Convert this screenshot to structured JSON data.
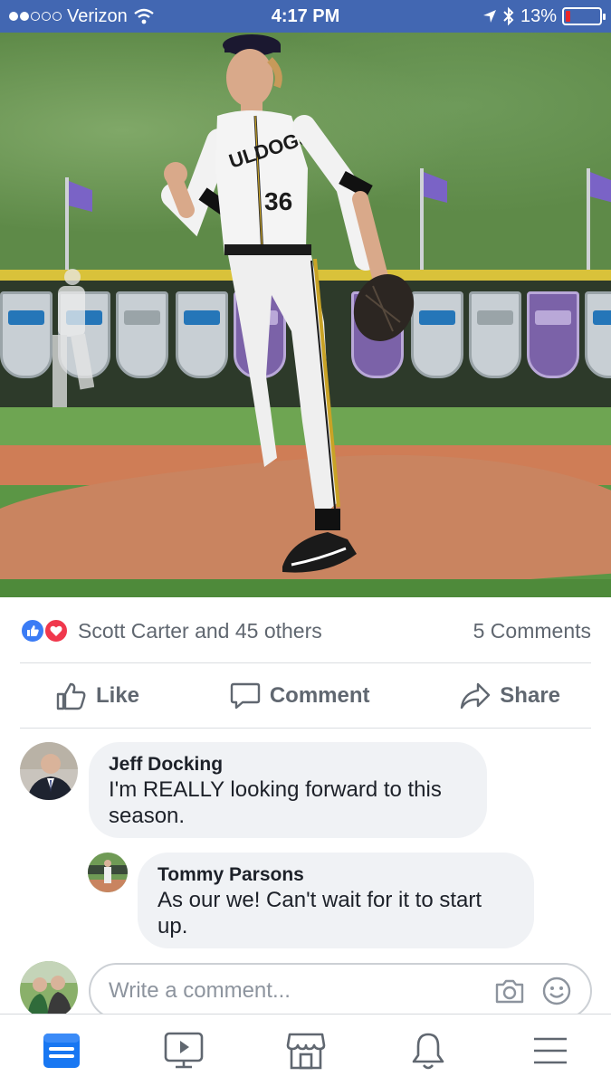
{
  "status_bar": {
    "carrier": "Verizon",
    "time": "4:17 PM",
    "battery": "13%",
    "battery_level": 0.13,
    "signal_bars_filled": 2,
    "signal_bars_total": 5
  },
  "post": {
    "reactions_text": "Scott Carter and 45 others",
    "comments_count": "5 Comments",
    "reaction_icons": [
      "like-icon",
      "love-icon"
    ]
  },
  "actions": {
    "like": "Like",
    "comment": "Comment",
    "share": "Share"
  },
  "comments": [
    {
      "author": "Jeff Docking",
      "text": "I'm REALLY looking forward to this season."
    },
    {
      "author": "Tommy Parsons",
      "text": "As our we! Can't wait for it to start up."
    }
  ],
  "composer": {
    "placeholder": "Write a comment..."
  },
  "tabs": [
    {
      "name": "news-feed-icon",
      "active": true
    },
    {
      "name": "watch-icon",
      "active": false
    },
    {
      "name": "marketplace-icon",
      "active": false
    },
    {
      "name": "notifications-icon",
      "active": false
    },
    {
      "name": "menu-icon",
      "active": false
    }
  ],
  "colors": {
    "brand": "#4267b2",
    "active_tab": "#1877f2",
    "inactive_tab": "#606770",
    "like_blue": "#3b7cf5",
    "love_red": "#f0384d",
    "battery_low": "#e8262a"
  }
}
